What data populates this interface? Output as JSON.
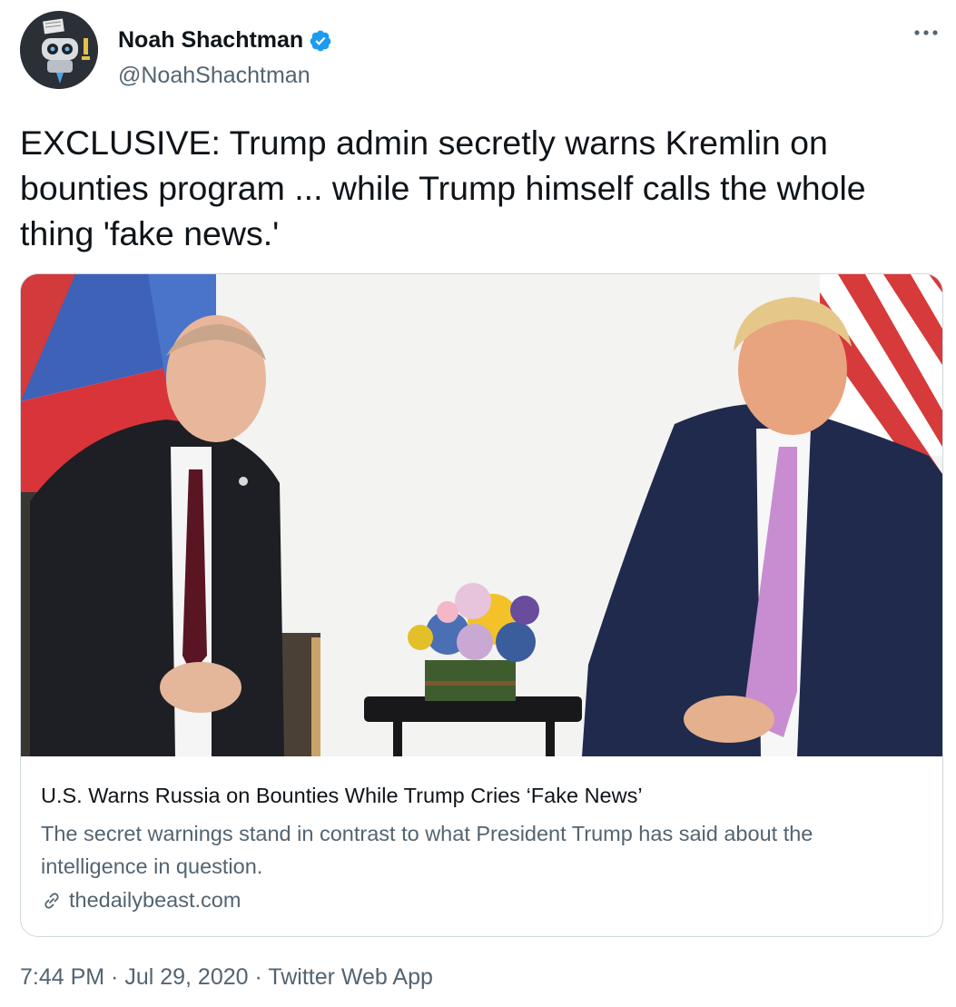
{
  "author": {
    "display_name": "Noah Shachtman",
    "handle": "@NoahShachtman",
    "verified": true
  },
  "tweet": {
    "text": "EXCLUSIVE: Trump admin secretly warns Kremlin on bounties program ... while Trump himself calls the whole thing 'fake news.'"
  },
  "card": {
    "title": "U.S. Warns Russia on Bounties While Trump Cries ‘Fake News’",
    "description": "The secret warnings stand in contrast to what President Trump has said about the intelligence in question.",
    "domain": "thedailybeast.com"
  },
  "footer": {
    "time": "7:44 PM",
    "date": "Jul 29, 2020",
    "source": "Twitter Web App",
    "separator": " · "
  },
  "icons": {
    "verified": "verified-badge-icon",
    "more": "more-horizontal-icon",
    "link": "link-icon"
  },
  "colors": {
    "text_primary": "#0f1419",
    "text_secondary": "#536471",
    "verified_blue": "#1d9bf0",
    "border": "#cfd9de"
  }
}
